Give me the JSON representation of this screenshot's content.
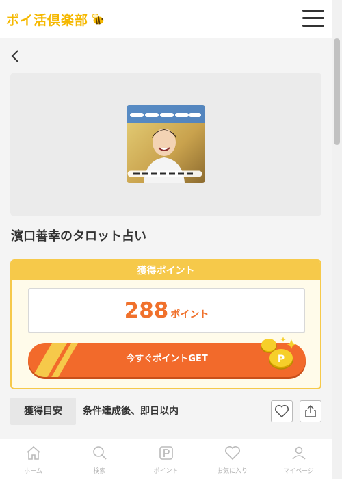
{
  "header": {
    "logo_text": "ポイ活倶楽部"
  },
  "campaign": {
    "title": "濱口善幸のタロット占い"
  },
  "points_card": {
    "heading": "獲得ポイント",
    "points": "288",
    "unit": "ポイント",
    "cta": "今すぐポイントGET"
  },
  "estimate": {
    "label": "獲得目安",
    "value": "条件達成後、即日以内"
  },
  "nav": [
    {
      "label": "ホーム",
      "icon": "home-icon"
    },
    {
      "label": "検索",
      "icon": "search-icon"
    },
    {
      "label": "ポイント",
      "icon": "point-icon"
    },
    {
      "label": "お気に入り",
      "icon": "heart-icon"
    },
    {
      "label": "マイページ",
      "icon": "user-icon"
    }
  ],
  "colors": {
    "accent": "#f26a2b",
    "brand": "#f5b800",
    "card_border": "#f6c94a"
  }
}
